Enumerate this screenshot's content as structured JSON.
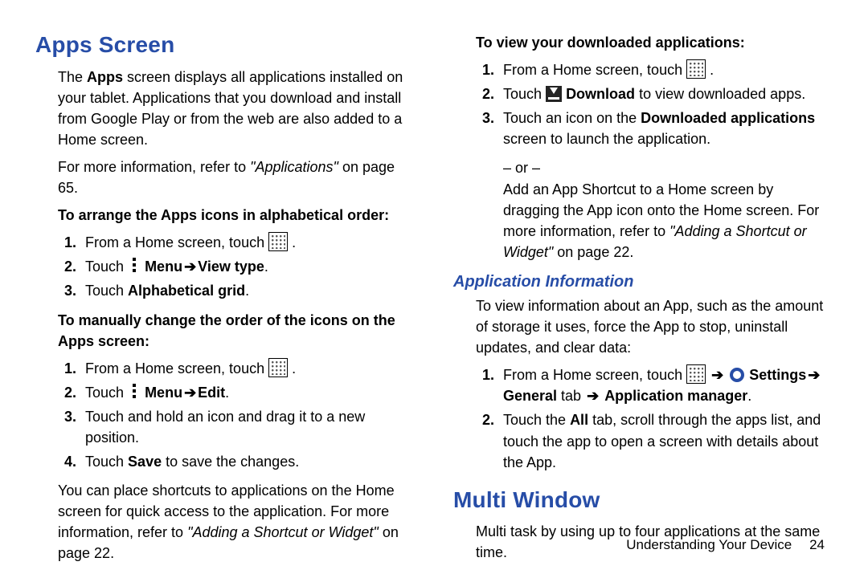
{
  "left": {
    "h1": "Apps Screen",
    "intro1a": "The ",
    "intro1b": "Apps",
    "intro1c": " screen displays all applications installed on your tablet. Applications that you download and install from Google Play or from the web are also added to a Home screen.",
    "intro2a": "For more information, refer to ",
    "intro2b": "\"Applications\"",
    "intro2c": " on page 65.",
    "sub1": "To arrange the Apps icons in alphabetical order:",
    "s1_1a": "From a Home screen, touch ",
    "s1_1b": " .",
    "s1_2a": "Touch ",
    "s1_2b": "Menu",
    "s1_2c": "View type",
    "s1_2d": ".",
    "s1_3a": "Touch ",
    "s1_3b": "Alphabetical grid",
    "s1_3c": ".",
    "sub2a": "To manually change the order of the icons on the Apps screen:",
    "s2_1a": "From a Home screen, touch ",
    "s2_1b": " .",
    "s2_2a": "Touch ",
    "s2_2b": "Menu",
    "s2_2c": "Edit",
    "s2_2d": ".",
    "s2_3": "Touch and hold an icon and drag it to a new position.",
    "s2_4a": "Touch ",
    "s2_4b": "Save",
    "s2_4c": " to save the changes.",
    "post_a": "You can place shortcuts to applications on the Home screen for quick access to the application. For more information, refer to ",
    "post_b": "\"Adding a Shortcut or Widget\"",
    "post_c": " on page 22."
  },
  "right": {
    "sub1": "To view your downloaded applications:",
    "r1_1a": "From a Home screen, touch ",
    "r1_1b": " .",
    "r1_2a": "Touch ",
    "r1_2b": "Download",
    "r1_2c": " to view downloaded apps.",
    "r1_3a": "Touch an icon on the ",
    "r1_3b": "Downloaded applications",
    "r1_3c": " screen to launch the application.",
    "or": "– or –",
    "r1_add_a": "Add an App Shortcut to a Home screen by dragging the App icon onto the Home screen. For more information, refer to ",
    "r1_add_b": "\"Adding a Shortcut or Widget\"",
    "r1_add_c": " on page 22.",
    "h2": "Application Information",
    "ai_intro": "To view information about an App, such as the amount of storage it uses, force the App to stop, uninstall updates, and clear data:",
    "ai_1a": "From a Home screen, touch ",
    "ai_1b": "Settings",
    "ai_1c": "General",
    "ai_1d": " tab ",
    "ai_1e": "Application manager",
    "ai_2a": "Touch the ",
    "ai_2b": "All",
    "ai_2c": " tab, scroll through the apps list, and touch the app to open a screen with details about the App.",
    "h1b": "Multi Window",
    "mw": "Multi task by using up to four applications at the same time."
  },
  "footer": {
    "section": "Understanding Your Device",
    "page": "24"
  }
}
